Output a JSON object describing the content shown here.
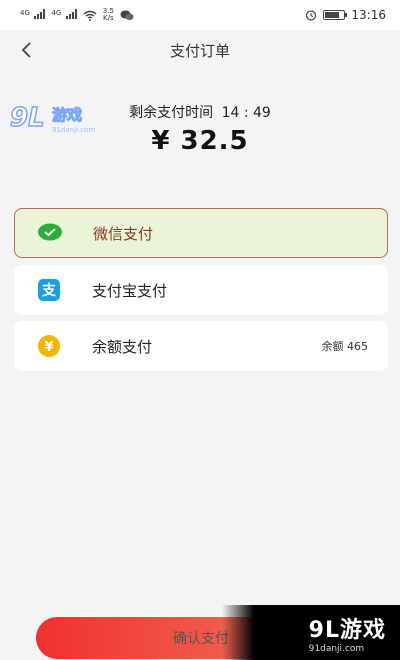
{
  "status_bar": {
    "net1": "4G",
    "net2": "4G",
    "speed_value": "3.5",
    "speed_unit": "K/s",
    "time": "13:16"
  },
  "header": {
    "title": "支付订单"
  },
  "order": {
    "timer_label": "剩余支付时间",
    "timer_value": "14 : 49",
    "amount": "¥ 32.5"
  },
  "payment_methods": [
    {
      "label": "微信支付",
      "icon": "wechat-pay-icon",
      "selected": true
    },
    {
      "label": "支付宝支付",
      "icon": "alipay-icon",
      "selected": false
    },
    {
      "label": "余额支付",
      "icon": "balance-icon",
      "selected": false,
      "extra": "余额 465"
    }
  ],
  "confirm": {
    "label": "确认支付"
  },
  "watermark": {
    "brand": "9L游戏",
    "domain": "91danji.com"
  },
  "colors": {
    "accent_red": "#f2302f",
    "selected_bg": "#e9f5d6",
    "selected_border": "#b46a55",
    "wechat_green": "#2aae3a",
    "alipay_blue": "#1aa0e0",
    "balance_yellow": "#f5b400"
  }
}
